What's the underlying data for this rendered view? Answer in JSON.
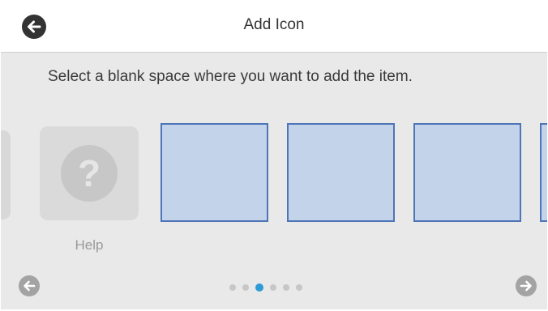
{
  "header": {
    "title": "Add Icon",
    "back_icon": "arrow-left-icon"
  },
  "instruction": "Select a blank space where you want to add the item.",
  "tiles": {
    "help": {
      "label": "Help",
      "glyph": "?",
      "icon": "question-mark-icon"
    },
    "blank_slots": 4
  },
  "pagination": {
    "pages": 6,
    "active_page": 3,
    "prev_icon": "arrow-left-icon",
    "next_icon": "arrow-right-icon"
  },
  "colors": {
    "slot_fill": "#c3d3ea",
    "slot_border": "#4e75b7",
    "active_dot": "#2f9ad6"
  }
}
